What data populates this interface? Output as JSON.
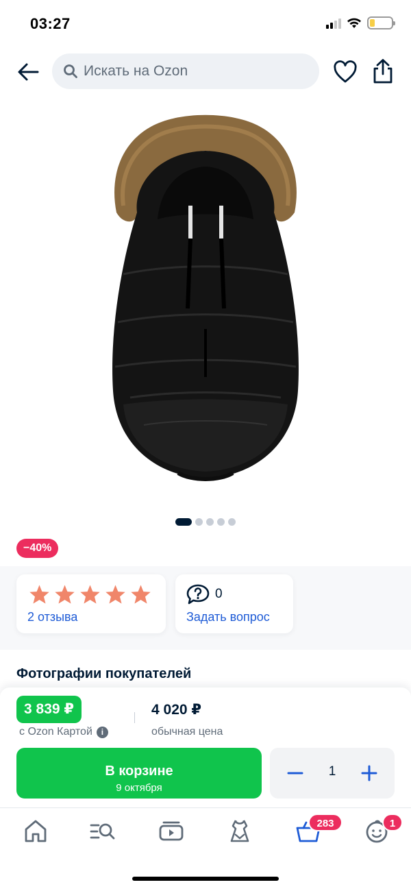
{
  "status_bar": {
    "time": "03:27"
  },
  "header": {
    "search_placeholder": "Искать на Ozon",
    "icons": [
      "back-arrow-icon",
      "search-icon",
      "heart-icon",
      "share-icon"
    ]
  },
  "product": {
    "image_count": 5,
    "active_image": 1,
    "discount": "−40%"
  },
  "rating": {
    "stars": 5,
    "reviews_label": "2 отзыва"
  },
  "questions": {
    "count": "0",
    "ask_label": "Задать вопрос"
  },
  "sections": {
    "buyer_photos_title": "Фотографии покупателей"
  },
  "price_panel": {
    "card_price": "3 839 ₽",
    "card_price_label": "с Ozon Картой",
    "regular_price": "4 020 ₽",
    "regular_price_label": "обычная цена",
    "cart_button_title": "В корзине",
    "cart_button_subtitle": "9 октября",
    "quantity": "1"
  },
  "bottom_nav": {
    "items": [
      "home-icon",
      "catalog-search-icon",
      "video-icon",
      "fashion-icon",
      "cart-icon",
      "profile-icon"
    ],
    "cart_badge": "283",
    "profile_badge": "1"
  },
  "colors": {
    "accent_green": "#10c44c",
    "discount_red": "#ec2d5e",
    "link_blue": "#1e5bd6",
    "star_orange": "#f0866a",
    "text_dark": "#001a34"
  }
}
